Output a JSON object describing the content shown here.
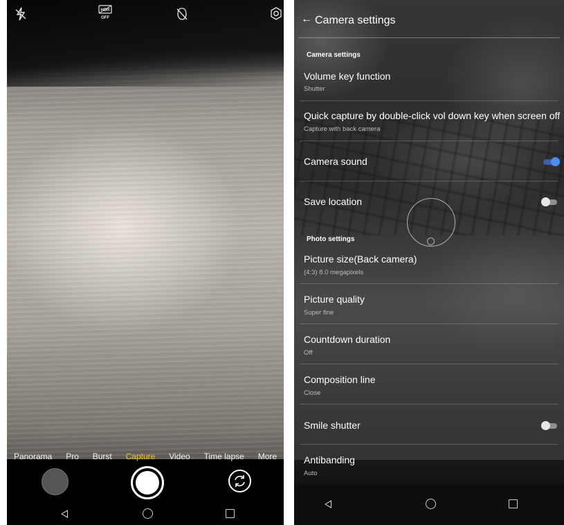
{
  "camera": {
    "top_icons": [
      "flash-off-icon",
      "hdr-off-icon",
      "beauty-off-icon",
      "settings-icon"
    ],
    "modes": [
      {
        "label": "Panorama",
        "active": false
      },
      {
        "label": "Pro",
        "active": false
      },
      {
        "label": "Burst",
        "active": false
      },
      {
        "label": "Capture",
        "active": true
      },
      {
        "label": "Video",
        "active": false
      },
      {
        "label": "Time lapse",
        "active": false
      },
      {
        "label": "More",
        "active": false
      }
    ],
    "active_color": "#f5c518"
  },
  "settings": {
    "header_title": "Camera settings",
    "back_icon": "←",
    "sections": {
      "camera": "Camera settings",
      "photo": "Photo settings"
    },
    "items": [
      {
        "title": "Volume key function",
        "subtitle": "Shutter"
      },
      {
        "title": "Quick capture by double-click vol down key when screen off",
        "subtitle": "Capture with back camera"
      },
      {
        "title": "Camera sound",
        "toggle": true
      },
      {
        "title": "Save location",
        "toggle": false
      },
      {
        "title": "Picture size(Back camera)",
        "subtitle": "(4:3) 8.0 megapixels"
      },
      {
        "title": "Picture quality",
        "subtitle": "Super fine"
      },
      {
        "title": "Countdown duration",
        "subtitle": "Off"
      },
      {
        "title": "Composition line",
        "subtitle": "Close"
      },
      {
        "title": "Smile shutter",
        "toggle": false
      },
      {
        "title": "Antibanding",
        "subtitle": "Auto"
      }
    ],
    "toggle_on_color": "#4d8ef0"
  },
  "hdr_icon_text": {
    "top": "HDR",
    "bottom": "OFF"
  }
}
